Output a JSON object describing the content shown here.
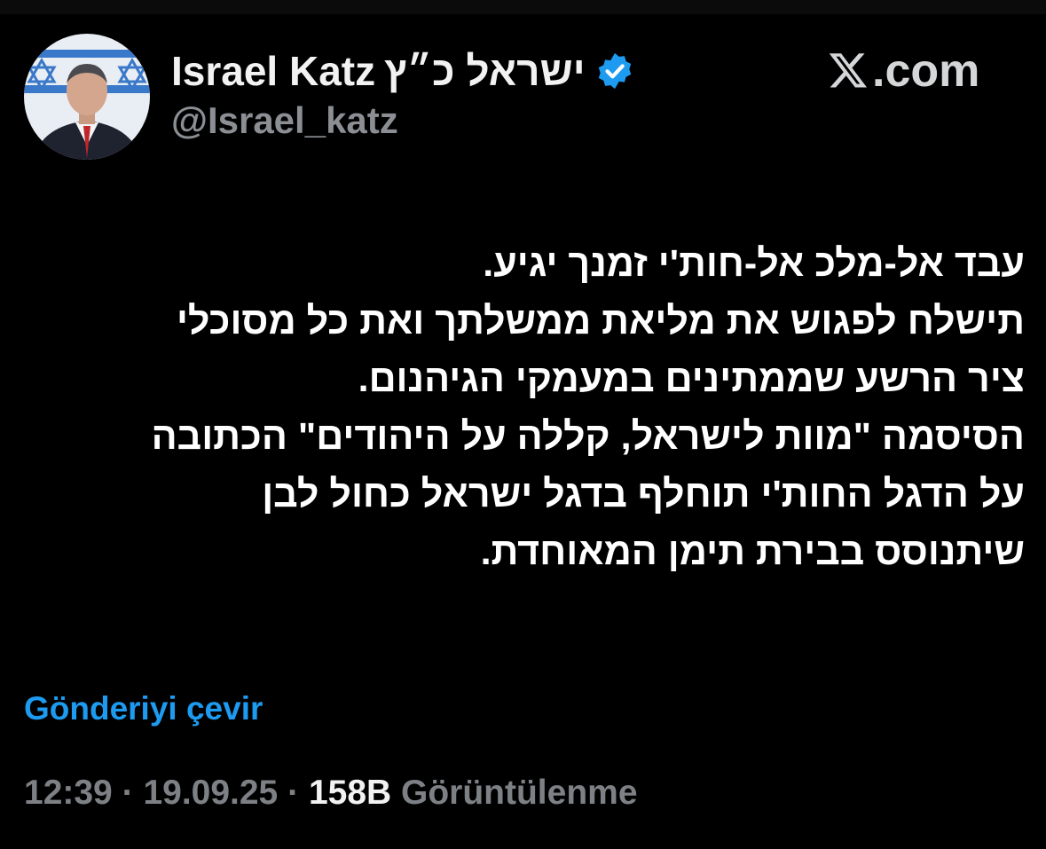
{
  "source": {
    "brand": ".com"
  },
  "author": {
    "display_name_en": "Israel Katz",
    "display_name_he": "ישראל כ״ץ",
    "handle": "@Israel_katz",
    "avatar_icon": "user-avatar",
    "verified_icon": "verified-badge-icon",
    "verified_color": "#1d9bf0"
  },
  "tweet": {
    "lines": [
      "עבד אל-מלכ אל-חות'י זמנך יגיע.",
      "תישלח לפגוש את מליאת ממשלתך ואת כל מסוכלי",
      "ציר הרשע שממתינים במעמקי הגיהנום.",
      "הסיסמה \"מוות לישראל, קללה על היהודים\" הכתובה",
      "על הדגל החות'י תוחלף בדגל ישראל כחול לבן",
      "שיתנוסס בבירת תימן המאוחדת."
    ]
  },
  "actions": {
    "translate_label": "Gönderiyi çevir"
  },
  "meta": {
    "time": "12:39",
    "separator": "·",
    "date": "19.09.25",
    "views_count": "158B",
    "views_label": "Görüntülenme"
  },
  "colors": {
    "background": "#000000",
    "link": "#1d9bf0",
    "muted": "#7d8185"
  }
}
